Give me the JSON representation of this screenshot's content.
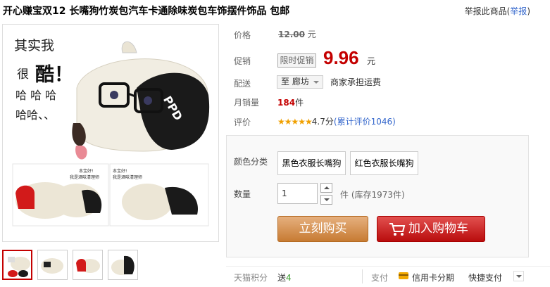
{
  "product": {
    "title": "开心赚宝双12 长嘴狗竹炭包汽车卡通除味炭包车饰摆件饰品 包邮",
    "report_text": "举报此商品(",
    "report_link": "举报",
    "report_close": ")",
    "image_text": {
      "line1": "其实我",
      "line2_a": "很",
      "line2_b": "酷！",
      "line3": "哈 哈 哈",
      "line4": "哈哈、、",
      "shirt": "PPD",
      "small_line1": "本宝好!",
      "small_line2": "我是酒味清理师",
      "small_line3": "本宝好!",
      "small_line4": "我是酒味清理师"
    }
  },
  "price": {
    "label": "价格",
    "original": "12.00",
    "unit": "元"
  },
  "promo": {
    "label": "促销",
    "tag": "限时促销",
    "price": "9.96",
    "unit": "元"
  },
  "shipping": {
    "label": "配送",
    "to": "至",
    "city": "廊坊",
    "note": "商家承担运费"
  },
  "sales": {
    "label": "月销量",
    "count": "184",
    "unit": "件"
  },
  "rating": {
    "label": "评价",
    "stars": "★★★★★",
    "score": "4.7分",
    "reviews_link": "(累计评价1046)"
  },
  "spec": {
    "color_label": "颜色分类",
    "options": [
      "黑色衣服长嘴狗",
      "红色衣服长嘴狗"
    ],
    "qty_label": "数量",
    "qty_value": "1",
    "stock_text": "件 (库存1973件)"
  },
  "actions": {
    "buy_now": "立刻购买",
    "add_cart": "加入购物车"
  },
  "bottom": {
    "points_label": "天猫积分",
    "points_prefix": "送",
    "points_value": "4",
    "pay_label": "支付",
    "card_text": "信用卡分期",
    "quick_text": "快捷支付"
  },
  "colors": {
    "price_red": "#c40000",
    "link_blue": "#3366cc",
    "buy_button": "#c77b33",
    "cart_button": "#b90d0d",
    "points_green": "#3a9c2e",
    "star_gold": "#f0a000"
  }
}
